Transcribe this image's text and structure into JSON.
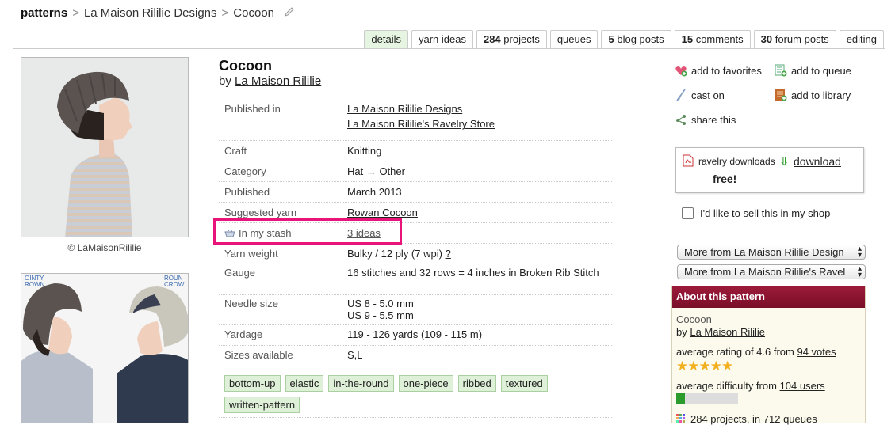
{
  "breadcrumb": {
    "root": "patterns",
    "designer": "La Maison Rililie Designs",
    "pattern": "Cocoon"
  },
  "tabs": [
    {
      "label": "details",
      "active": true
    },
    {
      "label": "yarn ideas"
    },
    {
      "count": "284",
      "label": "projects"
    },
    {
      "label": "queues"
    },
    {
      "count": "5",
      "label": "blog posts"
    },
    {
      "count": "15",
      "label": "comments"
    },
    {
      "count": "30",
      "label": "forum posts"
    },
    {
      "label": "editing"
    }
  ],
  "photo": {
    "credit": "© LaMaisonRililie",
    "second_labels": {
      "left": "OINTY\nROWN",
      "right": "ROUN\nCROW"
    }
  },
  "pattern": {
    "title": "Cocoon",
    "by_prefix": "by",
    "designer": "La Maison Rililie"
  },
  "details": {
    "published_in_label": "Published in",
    "published_in_1": "La Maison Rililie Designs",
    "published_in_2": "La Maison Rililie's Ravelry Store",
    "craft_label": "Craft",
    "craft": "Knitting",
    "category_label": "Category",
    "category": "Hat → Other",
    "published_label": "Published",
    "published": "March 2013",
    "suggested_yarn_label": "Suggested yarn",
    "suggested_yarn": "Rowan Cocoon",
    "stash_label": "In my stash",
    "stash_value": "3 ideas",
    "yarn_weight_label": "Yarn weight",
    "yarn_weight": "Bulky / 12 ply (7 wpi)",
    "yarn_weight_help": "?",
    "gauge_label": "Gauge",
    "gauge": "16 stitches and 32 rows = 4 inches in Broken Rib Stitch",
    "needle_label": "Needle size",
    "needle_1": "US 8 - 5.0 mm",
    "needle_2": "US 9 - 5.5 mm",
    "yardage_label": "Yardage",
    "yardage": "119 - 126 yards (109 - 115 m)",
    "sizes_label": "Sizes available",
    "sizes": "S,L"
  },
  "tags": [
    "bottom-up",
    "elastic",
    "in-the-round",
    "one-piece",
    "ribbed",
    "textured",
    "written-pattern"
  ],
  "actions": {
    "favorites": "add to favorites",
    "queue": "add to queue",
    "cast_on": "cast on",
    "library": "add to library",
    "share": "share this"
  },
  "download": {
    "source": "ravelry downloads",
    "link": "download",
    "price": "free!"
  },
  "sell_label": "I'd like to sell this in my shop",
  "selects": {
    "more_designs": "More from La Maison Rililie Design",
    "more_store": "More from La Maison Rililie's Ravel"
  },
  "about": {
    "header": "About this pattern",
    "name": "Cocoon",
    "by_prefix": "by",
    "designer": "La Maison Rililie",
    "rating_prefix": "average rating of 4.6 from",
    "rating_votes": "94 votes",
    "rating_value": 4.6,
    "difficulty_prefix": "average difficulty from",
    "difficulty_users": "104 users",
    "difficulty_fraction": 0.14,
    "projects": "284 projects, in 712 queues"
  },
  "colors": {
    "highlight": "#e8147a",
    "about_header": "#8c1432",
    "tag_bg": "#dff0d8",
    "active_tab": "#e6f4e2"
  }
}
